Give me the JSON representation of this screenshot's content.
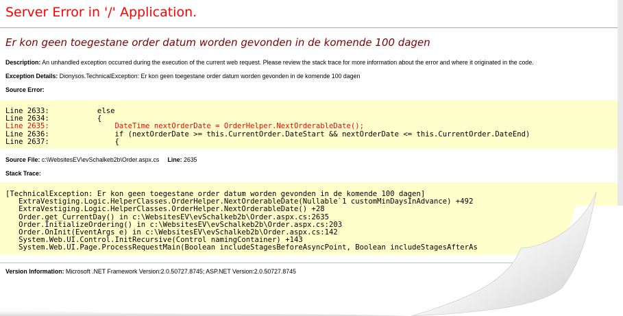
{
  "header": {
    "title": "Server Error in '/' Application.",
    "subtitle": "Er kon geen toegestane order datum worden gevonden in de komende 100 dagen"
  },
  "description": {
    "label": "Description:",
    "text": "An unhandled exception occurred during the execution of the current web request. Please review the stack trace for more information about the error and where it originated in the code."
  },
  "exception": {
    "label": "Exception Details:",
    "text": "Dionysos.TechnicalException: Er kon geen toegestane order datum worden gevonden in de komende 100 dagen"
  },
  "source_error": {
    "label": "Source Error:",
    "lines": [
      "Line 2633:           else",
      "Line 2634:           {",
      "Line 2635:               DateTime nextOrderDate = OrderHelper.NextOrderableDate();",
      "Line 2636:               if (nextOrderDate >= this.CurrentOrder.DateStart && nextOrderDate <= this.CurrentOrder.DateEnd)",
      "Line 2637:               {"
    ]
  },
  "source_file": {
    "label": "Source File:",
    "path": "c:\\WebsitesEV\\evSchalkeb2b\\Order.aspx.cs",
    "line_label": "Line:",
    "line_value": "2635"
  },
  "stack_trace": {
    "label": "Stack Trace:",
    "lines": [
      "[TechnicalException: Er kon geen toegestane order datum worden gevonden in de komende 100 dagen]",
      "   ExtraVestiging.Logic.HelperClasses.OrderHelper.NextOrderableDate(Nullable`1 customMinDaysInAdvance) +492",
      "   ExtraVestiging.Logic.HelperClasses.OrderHelper.NextOrderableDate() +28",
      "   Order.get_CurrentDay() in c:\\WebsitesEV\\evSchalkeb2b\\Order.aspx.cs:2635",
      "   Order.InitializeOrdering() in c:\\WebsitesEV\\evSchalkeb2b\\Order.aspx.cs:203",
      "   Order.OnInit(EventArgs e) in c:\\WebsitesEV\\evSchalkeb2b\\Order.aspx.cs:142",
      "   System.Web.UI.Control.InitRecursive(Control namingContainer) +143",
      "   System.Web.UI.Page.ProcessRequestMain(Boolean includeStagesBeforeAsyncPoint, Boolean includeStagesAfterAs"
    ]
  },
  "version": {
    "label": "Version Information:",
    "text": "Microsoft .NET Framework Version:2.0.50727.8745; ASP.NET Version:2.0.50727.8745"
  },
  "colors": {
    "title": "#ff0000",
    "subtitle": "#800000",
    "code_background": "#ffffcc",
    "error_line": "#ff0000"
  }
}
